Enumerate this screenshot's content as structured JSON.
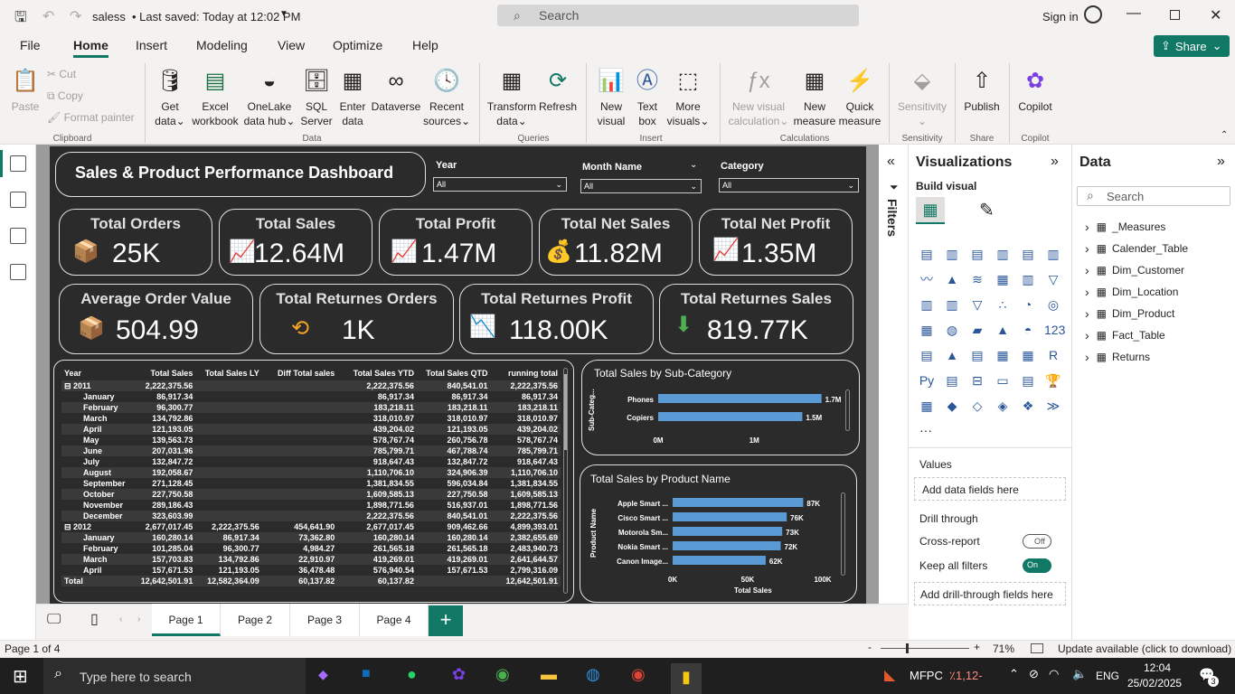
{
  "titlebar": {
    "file_name": "saless",
    "saved": "• Last saved: Today at 12:02 PM",
    "search_placeholder": "Search",
    "sign_in": "Sign in"
  },
  "menu": [
    "File",
    "Home",
    "Insert",
    "Modeling",
    "View",
    "Optimize",
    "Help"
  ],
  "share_label": "Share",
  "ribbon": {
    "clipboard": {
      "paste": "Paste",
      "cut": "Cut",
      "copy": "Copy",
      "format_painter": "Format painter",
      "group": "Clipboard"
    },
    "data": {
      "get_data": [
        "Get",
        "data"
      ],
      "excel": [
        "Excel",
        "workbook"
      ],
      "onelake": [
        "OneLake",
        "data hub"
      ],
      "sql": [
        "SQL",
        "Server"
      ],
      "enter": [
        "Enter",
        "data"
      ],
      "dataverse": "Dataverse",
      "recent": [
        "Recent",
        "sources"
      ],
      "group": "Data"
    },
    "queries": {
      "transform": [
        "Transform",
        "data"
      ],
      "refresh": "Refresh",
      "group": "Queries"
    },
    "insert": {
      "new_visual": [
        "New",
        "visual"
      ],
      "text_box": [
        "Text",
        "box"
      ],
      "more_visuals": [
        "More",
        "visuals"
      ],
      "group": "Insert"
    },
    "calculations": {
      "new_visual_calc": [
        "New visual",
        "calculation"
      ],
      "new_measure": [
        "New",
        "measure"
      ],
      "quick_measure": [
        "Quick",
        "measure"
      ],
      "group": "Calculations"
    },
    "sensitivity": {
      "label": "Sensitivity",
      "group": "Sensitivity"
    },
    "share": {
      "publish": "Publish",
      "group": "Share"
    },
    "copilot": {
      "label": "Copilot",
      "group": "Copilot"
    }
  },
  "report": {
    "title": "Sales & Product Performance Dashboard",
    "slicers": [
      {
        "label": "Year",
        "value": "All"
      },
      {
        "label": "Month Name",
        "value": "All"
      },
      {
        "label": "Category",
        "value": "All"
      }
    ],
    "kpis_row1": [
      {
        "title": "Total Orders",
        "value": "25K"
      },
      {
        "title": "Total Sales",
        "value": "12.64M"
      },
      {
        "title": "Total Profit",
        "value": "1.47M"
      },
      {
        "title": "Total Net Sales",
        "value": "11.82M"
      },
      {
        "title": "Total Net Profit",
        "value": "1.35M"
      }
    ],
    "kpis_row2": [
      {
        "title": "Average Order Value",
        "value": "504.99"
      },
      {
        "title": "Total Returnes Orders",
        "value": "1K"
      },
      {
        "title": "Total Returnes Profit",
        "value": "118.00K"
      },
      {
        "title": "Total Returnes Sales",
        "value": "819.77K"
      }
    ],
    "matrix": {
      "headers": [
        "Year",
        "Total Sales",
        "Total Sales LY",
        "Diff Total sales",
        "Total Sales YTD",
        "Total Sales QTD",
        "running total"
      ],
      "rows": [
        [
          "⊟ 2011",
          "2,222,375.56",
          "",
          "",
          "2,222,375.56",
          "840,541.01",
          "2,222,375.56"
        ],
        [
          "January",
          "86,917.34",
          "",
          "",
          "86,917.34",
          "86,917.34",
          "86,917.34"
        ],
        [
          "February",
          "96,300.77",
          "",
          "",
          "183,218.11",
          "183,218.11",
          "183,218.11"
        ],
        [
          "March",
          "134,792.86",
          "",
          "",
          "318,010.97",
          "318,010.97",
          "318,010.97"
        ],
        [
          "April",
          "121,193.05",
          "",
          "",
          "439,204.02",
          "121,193.05",
          "439,204.02"
        ],
        [
          "May",
          "139,563.73",
          "",
          "",
          "578,767.74",
          "260,756.78",
          "578,767.74"
        ],
        [
          "June",
          "207,031.96",
          "",
          "",
          "785,799.71",
          "467,788.74",
          "785,799.71"
        ],
        [
          "July",
          "132,847.72",
          "",
          "",
          "918,647.43",
          "132,847.72",
          "918,647.43"
        ],
        [
          "August",
          "192,058.67",
          "",
          "",
          "1,110,706.10",
          "324,906.39",
          "1,110,706.10"
        ],
        [
          "September",
          "271,128.45",
          "",
          "",
          "1,381,834.55",
          "596,034.84",
          "1,381,834.55"
        ],
        [
          "October",
          "227,750.58",
          "",
          "",
          "1,609,585.13",
          "227,750.58",
          "1,609,585.13"
        ],
        [
          "November",
          "289,186.43",
          "",
          "",
          "1,898,771.56",
          "516,937.01",
          "1,898,771.56"
        ],
        [
          "December",
          "323,603.99",
          "",
          "",
          "2,222,375.56",
          "840,541.01",
          "2,222,375.56"
        ],
        [
          "⊟ 2012",
          "2,677,017.45",
          "2,222,375.56",
          "454,641.90",
          "2,677,017.45",
          "909,462.66",
          "4,899,393.01"
        ],
        [
          "January",
          "160,280.14",
          "86,917.34",
          "73,362.80",
          "160,280.14",
          "160,280.14",
          "2,382,655.69"
        ],
        [
          "February",
          "101,285.04",
          "96,300.77",
          "4,984.27",
          "261,565.18",
          "261,565.18",
          "2,483,940.73"
        ],
        [
          "March",
          "157,703.83",
          "134,792.86",
          "22,910.97",
          "419,269.01",
          "419,269.01",
          "2,641,644.57"
        ],
        [
          "April",
          "157,671.53",
          "121,193.05",
          "36,478.48",
          "576,940.54",
          "157,671.53",
          "2,799,316.09"
        ],
        [
          "Total",
          "12,642,501.91",
          "12,582,364.09",
          "60,137.82",
          "60,137.82",
          "",
          "12,642,501.91"
        ]
      ]
    },
    "chart_data": [
      {
        "type": "bar",
        "title": "Total Sales by Sub-Category",
        "ylabel": "Sub-Categ...",
        "categories": [
          "Phones",
          "Copiers"
        ],
        "values": [
          1.7,
          1.5
        ],
        "data_labels": [
          "1.7M",
          "1.5M"
        ],
        "xticks": [
          "0M",
          "1M"
        ],
        "xlim": [
          0,
          1.75
        ]
      },
      {
        "type": "bar",
        "title": "Total Sales by Product Name",
        "ylabel": "Product Name",
        "xlabel": "Total Sales",
        "categories": [
          "Apple Smart ...",
          "Cisco Smart ...",
          "Motorola Sm...",
          "Nokia Smart ...",
          "Canon Image..."
        ],
        "values": [
          87,
          76,
          73,
          72,
          62
        ],
        "data_labels": [
          "87K",
          "76K",
          "73K",
          "72K",
          "62K"
        ],
        "xticks": [
          "0K",
          "50K",
          "100K"
        ],
        "xlim": [
          0,
          100
        ]
      }
    ]
  },
  "filters_label": "Filters",
  "viz": {
    "title": "Visualizations",
    "build": "Build visual",
    "values": "Values",
    "add_fields": "Add data fields here",
    "drill": "Drill through",
    "cross": "Cross-report",
    "cross_state": "Off",
    "keep": "Keep all filters",
    "keep_state": "On",
    "drill_add": "Add drill-through fields here"
  },
  "data_pane": {
    "title": "Data",
    "search": "Search",
    "tables": [
      "_Measures",
      "Calender_Table",
      "Dim_Customer",
      "Dim_Location",
      "Dim_Product",
      "Fact_Table",
      "Returns"
    ]
  },
  "pages": [
    "Page 1",
    "Page 2",
    "Page 3",
    "Page 4"
  ],
  "status": {
    "page": "Page 1 of 4",
    "zoom": "71%",
    "update": "Update available (click to download)"
  },
  "taskbar": {
    "search": "Type here to search",
    "stock": "MFPC",
    "stock_change": "٪1,12-",
    "lang": "ENG",
    "time": "12:04",
    "date": "25/02/2025",
    "notif": "3"
  }
}
